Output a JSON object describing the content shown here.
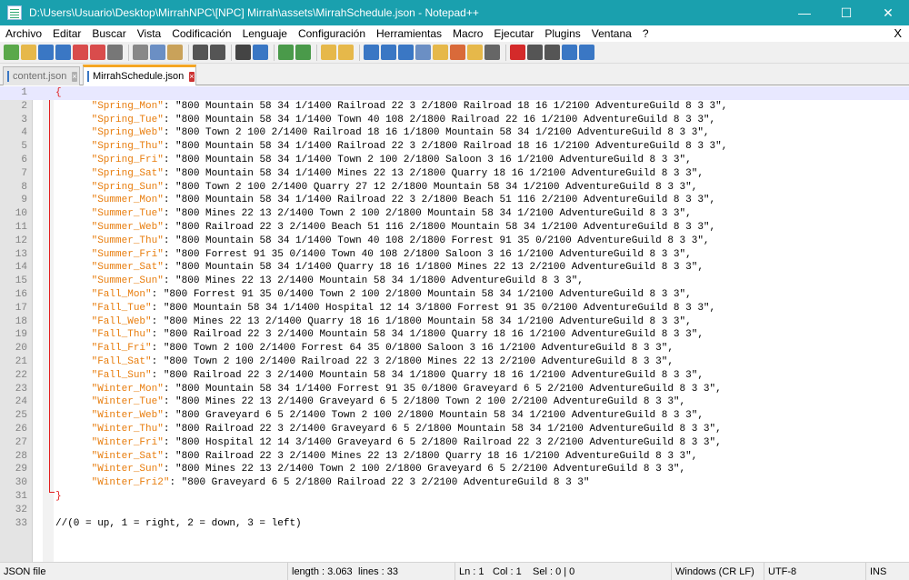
{
  "window": {
    "title": "D:\\Users\\Usuario\\Desktop\\MirrahNPC\\[NPC] Mirrah\\assets\\MirrahSchedule.json - Notepad++",
    "minimize": "—",
    "maximize": "☐",
    "close": "✕"
  },
  "menu": {
    "items": [
      "Archivo",
      "Editar",
      "Buscar",
      "Vista",
      "Codificación",
      "Lenguaje",
      "Configuración",
      "Herramientas",
      "Macro",
      "Ejecutar",
      "Plugins",
      "Ventana",
      "?"
    ],
    "close_doc": "X"
  },
  "tabs": [
    {
      "label": "content.json",
      "active": false
    },
    {
      "label": "MirrahSchedule.json",
      "active": true
    }
  ],
  "editor": {
    "open_brace": "{",
    "close_brace": "}",
    "entries": [
      {
        "key": "\"Spring_Mon\"",
        "value": "\"800 Mountain 58 34 1/1400 Railroad 22 3 2/1800 Railroad 18 16 1/2100 AdventureGuild 8 3 3\","
      },
      {
        "key": "\"Spring_Tue\"",
        "value": "\"800 Mountain 58 34 1/1400 Town 40 108 2/1800 Railroad 22 16 1/2100 AdventureGuild 8 3 3\","
      },
      {
        "key": "\"Spring_Web\"",
        "value": "\"800 Town 2 100 2/1400 Railroad 18 16 1/1800 Mountain 58 34 1/2100 AdventureGuild 8 3 3\","
      },
      {
        "key": "\"Spring_Thu\"",
        "value": "\"800 Mountain 58 34 1/1400 Railroad 22 3 2/1800 Railroad 18 16 1/2100 AdventureGuild 8 3 3\","
      },
      {
        "key": "\"Spring_Fri\"",
        "value": "\"800 Mountain 58 34 1/1400 Town 2 100 2/1800 Saloon 3 16 1/2100 AdventureGuild 8 3 3\","
      },
      {
        "key": "\"Spring_Sat\"",
        "value": "\"800 Mountain 58 34 1/1400 Mines 22 13 2/1800 Quarry 18 16 1/2100 AdventureGuild 8 3 3\","
      },
      {
        "key": "\"Spring_Sun\"",
        "value": "\"800 Town 2 100 2/1400 Quarry 27 12 2/1800 Mountain 58 34 1/2100 AdventureGuild 8 3 3\","
      },
      {
        "key": "\"Summer_Mon\"",
        "value": "\"800 Mountain 58 34 1/1400 Railroad 22 3 2/1800 Beach 51 116 2/2100 AdventureGuild 8 3 3\","
      },
      {
        "key": "\"Summer_Tue\"",
        "value": "\"800 Mines 22 13 2/1400 Town 2 100 2/1800 Mountain 58 34 1/2100 AdventureGuild 8 3 3\","
      },
      {
        "key": "\"Summer_Web\"",
        "value": "\"800 Railroad 22 3 2/1400 Beach 51 116 2/1800 Mountain 58 34 1/2100 AdventureGuild 8 3 3\","
      },
      {
        "key": "\"Summer_Thu\"",
        "value": "\"800 Mountain 58 34 1/1400 Town 40 108 2/1800 Forrest 91 35 0/2100 AdventureGuild 8 3 3\","
      },
      {
        "key": "\"Summer_Fri\"",
        "value": "\"800 Forrest 91 35 0/1400 Town 40 108 2/1800 Saloon 3 16 1/2100 AdventureGuild 8 3 3\","
      },
      {
        "key": "\"Summer_Sat\"",
        "value": "\"800 Mountain 58 34 1/1400 Quarry 18 16 1/1800 Mines 22 13 2/2100 AdventureGuild 8 3 3\","
      },
      {
        "key": "\"Summer_Sun\"",
        "value": "\"800 Mines 22 13 2/1400 Mountain 58 34 1/1800 AdventureGuild 8 3 3\","
      },
      {
        "key": "\"Fall_Mon\"",
        "value": "\"800 Forrest 91 35 0/1400 Town 2 100 2/1800 Mountain 58 34 1/2100 AdventureGuild 8 3 3\","
      },
      {
        "key": "\"Fall_Tue\"",
        "value": "\"800 Mountain 58 34 1/1400 Hospital 12 14 3/1800 Forrest 91 35 0/2100 AdventureGuild 8 3 3\","
      },
      {
        "key": "\"Fall_Web\"",
        "value": "\"800 Mines 22 13 2/1400 Quarry 18 16 1/1800 Mountain 58 34 1/2100 AdventureGuild 8 3 3\","
      },
      {
        "key": "\"Fall_Thu\"",
        "value": "\"800 Railroad 22 3 2/1400 Mountain 58 34 1/1800 Quarry 18 16 1/2100 AdventureGuild 8 3 3\","
      },
      {
        "key": "\"Fall_Fri\"",
        "value": "\"800 Town 2 100 2/1400 Forrest 64 35 0/1800 Saloon 3 16 1/2100 AdventureGuild 8 3 3\","
      },
      {
        "key": "\"Fall_Sat\"",
        "value": "\"800 Town 2 100 2/1400 Railroad 22 3 2/1800 Mines 22 13 2/2100 AdventureGuild 8 3 3\","
      },
      {
        "key": "\"Fall_Sun\"",
        "value": "\"800 Railroad 22 3 2/1400 Mountain 58 34 1/1800 Quarry 18 16 1/2100 AdventureGuild 8 3 3\","
      },
      {
        "key": "\"Winter_Mon\"",
        "value": "\"800 Mountain 58 34 1/1400 Forrest 91 35 0/1800 Graveyard 6 5 2/2100 AdventureGuild 8 3 3\","
      },
      {
        "key": "\"Winter_Tue\"",
        "value": "\"800 Mines 22 13 2/1400 Graveyard 6 5 2/1800 Town 2 100 2/2100 AdventureGuild 8 3 3\","
      },
      {
        "key": "\"Winter_Web\"",
        "value": "\"800 Graveyard 6 5 2/1400 Town 2 100 2/1800 Mountain 58 34 1/2100 AdventureGuild 8 3 3\","
      },
      {
        "key": "\"Winter_Thu\"",
        "value": "\"800 Railroad 22 3 2/1400 Graveyard 6 5 2/1800 Mountain 58 34 1/2100 AdventureGuild 8 3 3\","
      },
      {
        "key": "\"Winter_Fri\"",
        "value": "\"800 Hospital 12 14 3/1400 Graveyard 6 5 2/1800 Railroad 22 3 2/2100 AdventureGuild 8 3 3\","
      },
      {
        "key": "\"Winter_Sat\"",
        "value": "\"800 Railroad 22 3 2/1400 Mines 22 13 2/1800 Quarry 18 16 1/2100 AdventureGuild 8 3 3\","
      },
      {
        "key": "\"Winter_Sun\"",
        "value": "\"800 Mines 22 13 2/1400 Town 2 100 2/1800 Graveyard 6 5 2/2100 AdventureGuild 8 3 3\","
      },
      {
        "key": "\"Winter_Fri2\"",
        "value": "\"800 Graveyard 6 5 2/1800 Railroad 22 3 2/2100 AdventureGuild 8 3 3\""
      }
    ],
    "comment": "//(0 = up, 1 = right, 2 = down, 3 = left)",
    "line_numbers": [
      "1",
      "2",
      "3",
      "4",
      "5",
      "6",
      "7",
      "8",
      "9",
      "10",
      "11",
      "12",
      "13",
      "14",
      "15",
      "16",
      "17",
      "18",
      "19",
      "20",
      "21",
      "22",
      "23",
      "24",
      "25",
      "26",
      "27",
      "28",
      "29",
      "30",
      "31",
      "32",
      "33"
    ]
  },
  "status": {
    "file_type": "JSON file",
    "length": "length : 3.063",
    "lines": "lines : 33",
    "ln": "Ln : 1",
    "col": "Col : 1",
    "sel": "Sel : 0 | 0",
    "eol": "Windows (CR LF)",
    "encoding": "UTF-8",
    "mode": "INS"
  },
  "colors": {
    "titlebar": "#1aa0ae",
    "key": "#e87d0d",
    "fold": "#e21f1f",
    "active_tab": "#f5a623"
  }
}
